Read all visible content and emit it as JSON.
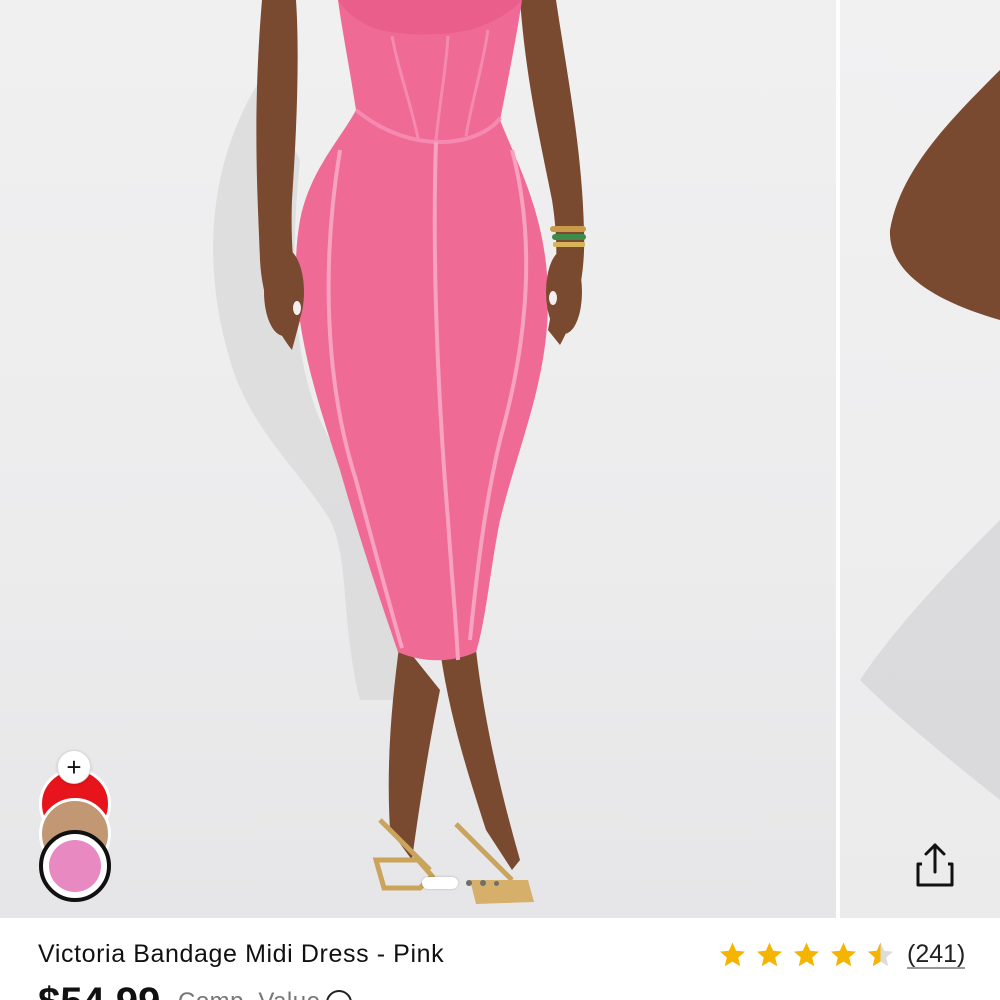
{
  "product": {
    "title": "Victoria Bandage Midi Dress - Pink",
    "price": "$54.99",
    "comp_value_label": "Comp. Value",
    "rating": 4.5,
    "review_count": "(241)"
  },
  "gallery": {
    "image_count": 4,
    "active_index": 0,
    "swatches": [
      {
        "name": "red",
        "color": "#e8141b"
      },
      {
        "name": "tan",
        "color": "#c29773"
      },
      {
        "name": "pink",
        "color": "#e889c2",
        "selected": true
      }
    ],
    "add_swatch_symbol": "+"
  },
  "colors": {
    "dress": "#f06a96",
    "star": "#f5b400",
    "text": "#111111"
  },
  "icons": {
    "share": "share-icon",
    "info": "info-icon",
    "star": "star-icon"
  }
}
